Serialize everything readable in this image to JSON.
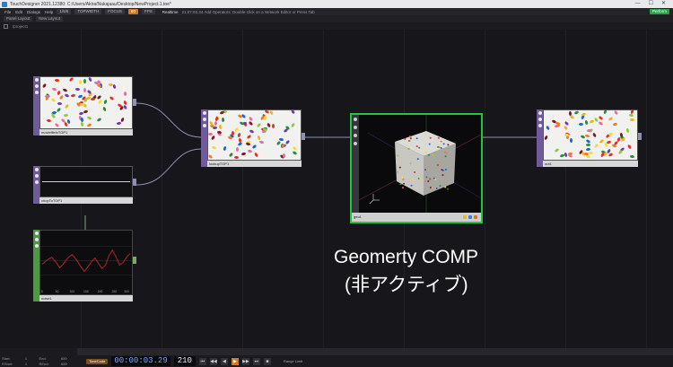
{
  "window": {
    "title": "TouchDesigner 2021.12380: C:/Users/Akira/Nakajaau/Desktop/NewProject.1.toe*",
    "controls": [
      "—",
      "☐",
      "✕"
    ]
  },
  "menubar": {
    "items": [
      "File",
      "Edit",
      "Dialogs",
      "Help"
    ],
    "chips": [
      "1/5/6",
      "TOPWIDTH",
      "FOCUS",
      "60",
      "FPS"
    ],
    "realtime": "Realtime",
    "status": "21:07:03.34 Add Operators: Double-click on a Network Editor or Press Tab",
    "perform": "Perform"
  },
  "panebar": {
    "items": [
      "Panel Layout",
      "New Layout"
    ]
  },
  "pathbar": {
    "path": "/project1"
  },
  "nodes": {
    "movie": {
      "label": "moviefileinTOP1"
    },
    "lookup": {
      "label": "lookupTOP1"
    },
    "chopin": {
      "label": "chopToTOP1"
    },
    "noise": {
      "label": "noise1",
      "axis": [
        "0",
        "50",
        "100",
        "150",
        "200",
        "250",
        "300"
      ]
    },
    "geo": {
      "label": "geo1"
    },
    "out": {
      "label": "out1"
    }
  },
  "annotation": {
    "line1": "Geomerty COMP",
    "line2": "(非アクティブ)"
  },
  "timeline": {
    "stats": [
      [
        "Start:",
        "1",
        "End:",
        "600"
      ],
      [
        "RStart:",
        "1",
        "REnd:",
        "600"
      ]
    ],
    "mode": "TimeCode",
    "timecode": "00:00:03.29",
    "frame": "210",
    "buttons": [
      "⏮",
      "◀◀",
      "◀",
      "▶",
      "▶▶",
      "⏭",
      "■"
    ],
    "range": "Range Limit"
  },
  "colors": {
    "geo_border": "#27c23e",
    "top_node": "#6f5a9b",
    "chop_node": "#4c9a3e",
    "accent": "#d5781d"
  }
}
